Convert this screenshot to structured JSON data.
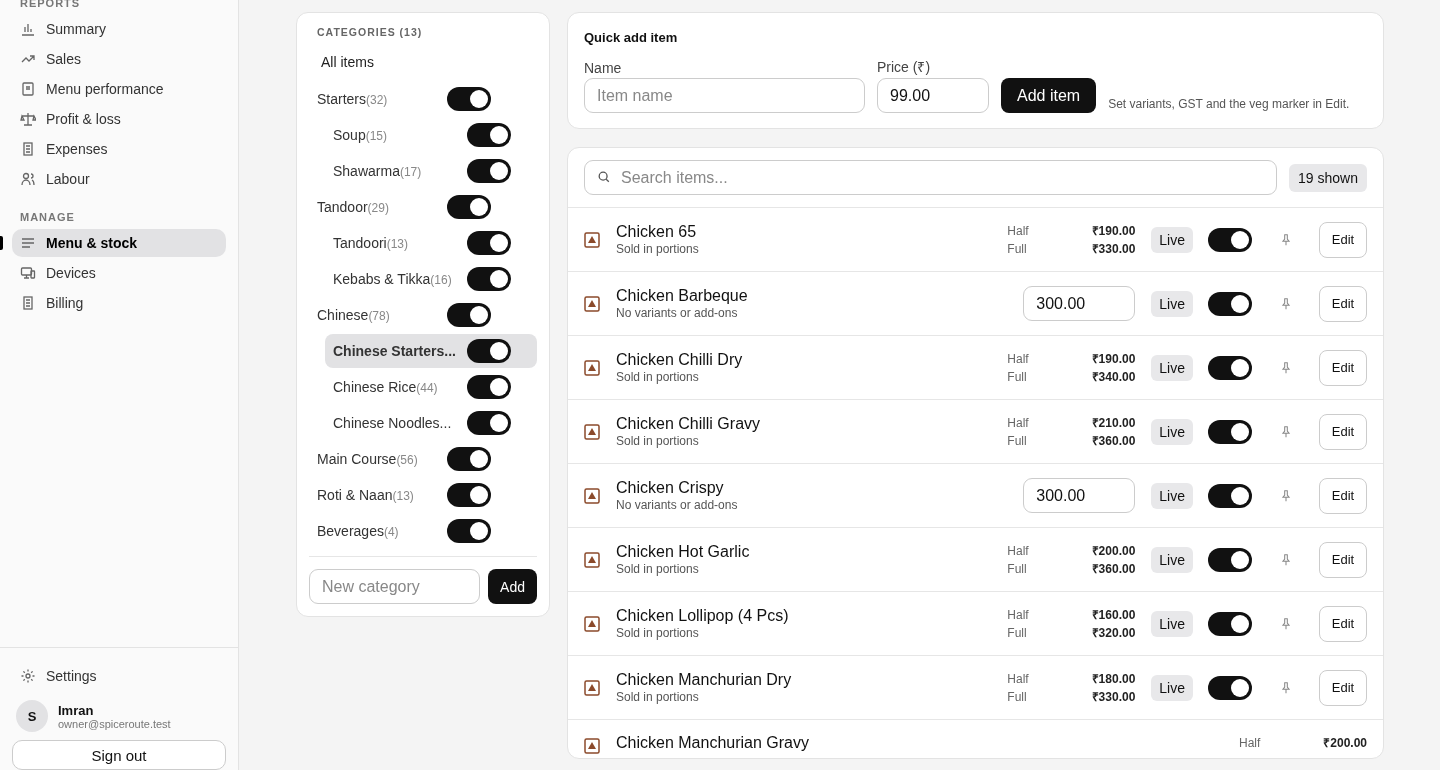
{
  "sidebar": {
    "sections": [
      {
        "heading": "REPORTS",
        "items": [
          {
            "label": "Summary",
            "kind": "chart",
            "selected": false
          },
          {
            "label": "Sales",
            "kind": "trend",
            "selected": false
          },
          {
            "label": "Menu performance",
            "kind": "doc",
            "selected": false
          },
          {
            "label": "Profit & loss",
            "kind": "scale",
            "selected": false
          },
          {
            "label": "Expenses",
            "kind": "receipt",
            "selected": false
          },
          {
            "label": "Labour",
            "kind": "users",
            "selected": false
          }
        ]
      },
      {
        "heading": "MANAGE",
        "items": [
          {
            "label": "Menu & stock",
            "kind": "lines",
            "selected": true
          },
          {
            "label": "Devices",
            "kind": "devices",
            "selected": false
          },
          {
            "label": "Billing",
            "kind": "receipt",
            "selected": false
          }
        ]
      }
    ],
    "settings": {
      "label": "Settings"
    },
    "user": {
      "initial": "S",
      "name": "Imran",
      "email": "owner@spiceroute.test"
    },
    "sign_out": "Sign out"
  },
  "categories": {
    "title": "CATEGORIES (13)",
    "all_items": {
      "label": "All items",
      "selected": false
    },
    "items": [
      {
        "name": "Starters",
        "count": "(32)",
        "on": true,
        "selected": false,
        "children": [
          {
            "name": "Soup",
            "count": "(15)",
            "on": true,
            "selected": false
          },
          {
            "name": "Shawarma",
            "count": "(17)",
            "on": true,
            "selected": false
          }
        ]
      },
      {
        "name": "Tandoor",
        "count": "(29)",
        "on": true,
        "selected": false,
        "children": [
          {
            "name": "Tandoori",
            "count": "(13)",
            "on": true,
            "selected": false
          },
          {
            "name": "Kebabs & Tikka",
            "count": "(16)",
            "on": true,
            "selected": false
          }
        ]
      },
      {
        "name": "Chinese",
        "count": "(78)",
        "on": true,
        "selected": false,
        "children": [
          {
            "name": "Chinese Starters...",
            "on": true,
            "selected": true
          },
          {
            "name": "Chinese Rice",
            "count": "(44)",
            "on": true,
            "selected": false
          },
          {
            "name": "Chinese Noodles...",
            "on": true,
            "selected": false
          }
        ]
      },
      {
        "name": "Main Course",
        "count": "(56)",
        "on": true,
        "selected": false
      },
      {
        "name": "Roti & Naan",
        "count": "(13)",
        "on": true,
        "selected": false
      },
      {
        "name": "Beverages",
        "count": "(4)",
        "on": true,
        "selected": false
      }
    ],
    "new_category": {
      "placeholder": "New category"
    },
    "add_button": "Add"
  },
  "quick_add": {
    "title": "Quick add item",
    "name_label": "Name",
    "name_placeholder": "Item name",
    "price_label": "Price (₹)",
    "price_value": "99.00",
    "button": "Add item",
    "hint": "Set variants, GST and the veg marker in Edit."
  },
  "items_list": {
    "search_placeholder": "Search items...",
    "shown": "19 shown",
    "rows": [
      {
        "name": "Chicken 65",
        "subtitle": "Sold in portions",
        "kind": "variants",
        "variants": [
          {
            "label": "Half",
            "price": "₹190.00"
          },
          {
            "label": "Full",
            "price": "₹330.00"
          }
        ],
        "status": "Live",
        "on": true,
        "edit": "Edit"
      },
      {
        "name": "Chicken Barbeque",
        "subtitle": "No variants or add-ons",
        "kind": "single",
        "price": "300.00",
        "status": "Live",
        "on": true,
        "edit": "Edit"
      },
      {
        "name": "Chicken Chilli Dry",
        "subtitle": "Sold in portions",
        "kind": "variants",
        "variants": [
          {
            "label": "Half",
            "price": "₹190.00"
          },
          {
            "label": "Full",
            "price": "₹340.00"
          }
        ],
        "status": "Live",
        "on": true,
        "edit": "Edit"
      },
      {
        "name": "Chicken Chilli Gravy",
        "subtitle": "Sold in portions",
        "kind": "variants",
        "variants": [
          {
            "label": "Half",
            "price": "₹210.00"
          },
          {
            "label": "Full",
            "price": "₹360.00"
          }
        ],
        "status": "Live",
        "on": true,
        "edit": "Edit"
      },
      {
        "name": "Chicken Crispy",
        "subtitle": "No variants or add-ons",
        "kind": "single",
        "price": "300.00",
        "status": "Live",
        "on": true,
        "edit": "Edit"
      },
      {
        "name": "Chicken Hot Garlic",
        "subtitle": "Sold in portions",
        "kind": "variants",
        "variants": [
          {
            "label": "Half",
            "price": "₹200.00"
          },
          {
            "label": "Full",
            "price": "₹360.00"
          }
        ],
        "status": "Live",
        "on": true,
        "edit": "Edit"
      },
      {
        "name": "Chicken Lollipop (4 Pcs)",
        "subtitle": "Sold in portions",
        "kind": "variants",
        "variants": [
          {
            "label": "Half",
            "price": "₹160.00"
          },
          {
            "label": "Full",
            "price": "₹320.00"
          }
        ],
        "status": "Live",
        "on": true,
        "edit": "Edit"
      },
      {
        "name": "Chicken Manchurian Dry",
        "subtitle": "Sold in portions",
        "kind": "variants",
        "variants": [
          {
            "label": "Half",
            "price": "₹180.00"
          },
          {
            "label": "Full",
            "price": "₹330.00"
          }
        ],
        "status": "Live",
        "on": true,
        "edit": "Edit"
      },
      {
        "name": "Chicken Manchurian Gravy",
        "kind": "variants",
        "variants": [
          {
            "label": "Half",
            "price": "₹200.00"
          }
        ]
      }
    ]
  }
}
